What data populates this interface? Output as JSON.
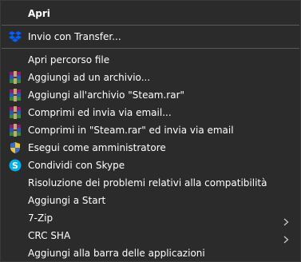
{
  "menu": {
    "items": [
      {
        "label": "Apri",
        "icon": null,
        "bold": true
      },
      {
        "label": "Invio con Transfer...",
        "icon": "dropbox-icon"
      },
      {
        "label": "Apri percorso file",
        "icon": null
      },
      {
        "label": "Aggiungi ad un archivio...",
        "icon": "winrar-icon"
      },
      {
        "label": "Aggiungi all'archivio \"Steam.rar\"",
        "icon": "winrar-icon"
      },
      {
        "label": "Comprimi ed invia via email...",
        "icon": "winrar-icon"
      },
      {
        "label": "Comprimi in \"Steam.rar\" ed invia via email",
        "icon": "winrar-icon"
      },
      {
        "label": "Esegui come amministratore",
        "icon": "uac-shield-icon"
      },
      {
        "label": "Condividi con Skype",
        "icon": "skype-icon"
      },
      {
        "label": "Risoluzione dei problemi relativi alla compatibilità",
        "icon": null
      },
      {
        "label": "Aggiungi a Start",
        "icon": null
      },
      {
        "label": "7-Zip",
        "icon": null,
        "submenu": true
      },
      {
        "label": "CRC SHA",
        "icon": null,
        "submenu": true
      },
      {
        "label": "Aggiungi alla barra delle applicazioni",
        "icon": null
      }
    ]
  },
  "colors": {
    "background": "#2b2b2b",
    "text": "#ffffff",
    "separator": "#5a5a5a",
    "dropbox": "#0061fe",
    "skype": "#00aff0"
  }
}
